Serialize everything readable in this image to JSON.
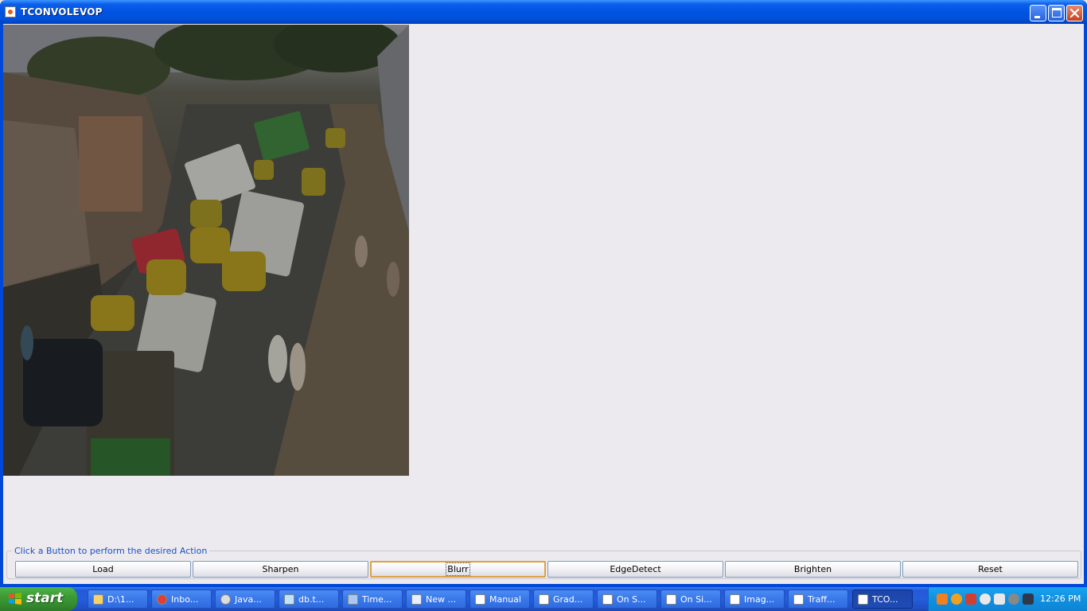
{
  "window": {
    "title": "TCONVOLEVOP"
  },
  "button_panel": {
    "legend": "Click a Button to perform the desired Action",
    "buttons": [
      "Load",
      "Sharpen",
      "Blurr",
      "EdgeDetect",
      "Brighten",
      "Reset"
    ],
    "focused": "Blurr"
  },
  "taskbar": {
    "start_label": "start",
    "items": [
      {
        "label": "D:\\1...",
        "icon": "folder-icon"
      },
      {
        "label": "Inbo...",
        "icon": "chrome-icon"
      },
      {
        "label": "Java...",
        "icon": "gear-icon"
      },
      {
        "label": "db.t...",
        "icon": "document-icon"
      },
      {
        "label": "Time...",
        "icon": "cube-icon"
      },
      {
        "label": "New ...",
        "icon": "word-icon"
      },
      {
        "label": "Manual",
        "icon": "java-icon"
      },
      {
        "label": "Grad...",
        "icon": "java-icon"
      },
      {
        "label": "On S...",
        "icon": "java-icon"
      },
      {
        "label": "On Si...",
        "icon": "java-icon"
      },
      {
        "label": "Imag...",
        "icon": "java-icon"
      },
      {
        "label": "Traff...",
        "icon": "java-icon"
      },
      {
        "label": "TCO...",
        "icon": "java-icon",
        "active": true
      }
    ],
    "clock": "12:26 PM"
  },
  "colors": {
    "titlebar": "#0054e3",
    "content_bg": "#eceaee",
    "legend_text": "#1a4fc3",
    "start_green": "#3c9a35",
    "focus_orange": "#e0a040"
  }
}
